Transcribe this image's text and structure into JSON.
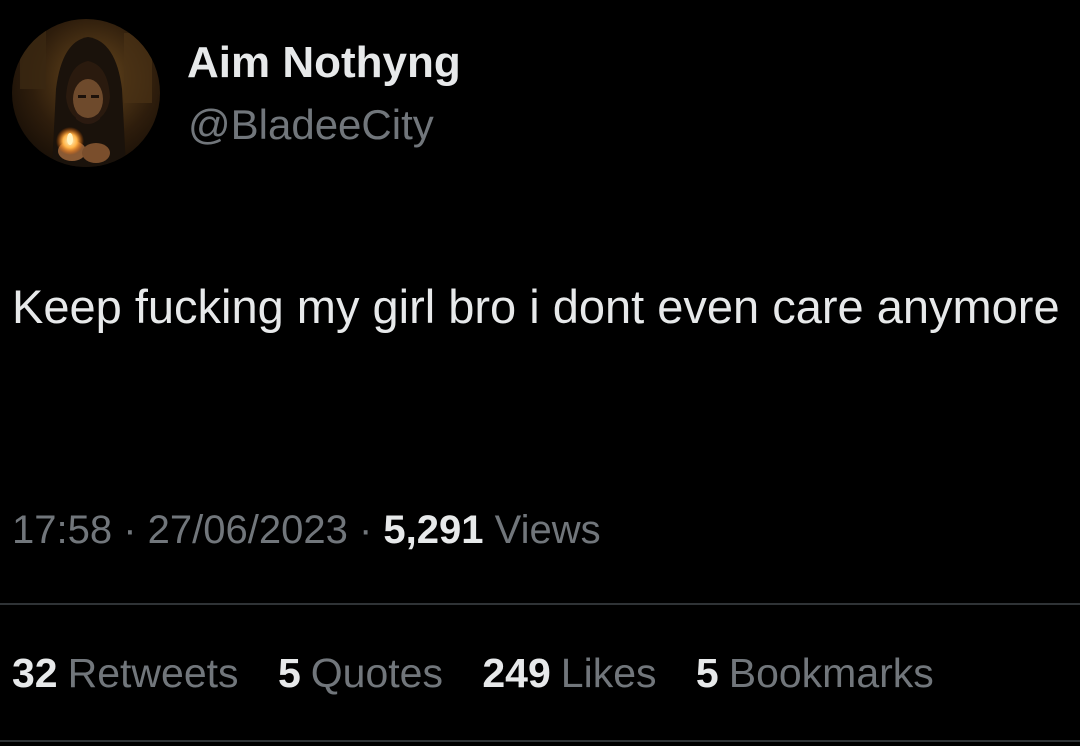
{
  "author": {
    "display_name": "Aim Nothyng",
    "handle": "@BladeeCity",
    "avatar": "hooded-figure-avatar"
  },
  "tweet": {
    "text": "Keep fucking my girl bro i dont even care anymore"
  },
  "meta": {
    "time": "17:58",
    "separator": " · ",
    "date": "27/06/2023",
    "views_count": "5,291",
    "views_label": "Views"
  },
  "stats": {
    "retweets_count": "32",
    "retweets_label": "Retweets",
    "quotes_count": "5",
    "quotes_label": "Quotes",
    "likes_count": "249",
    "likes_label": "Likes",
    "bookmarks_count": "5",
    "bookmarks_label": "Bookmarks"
  },
  "colors": {
    "background": "#000000",
    "primary_text": "#e7e9ea",
    "secondary_text": "#71767b",
    "divider": "#2f3336"
  }
}
